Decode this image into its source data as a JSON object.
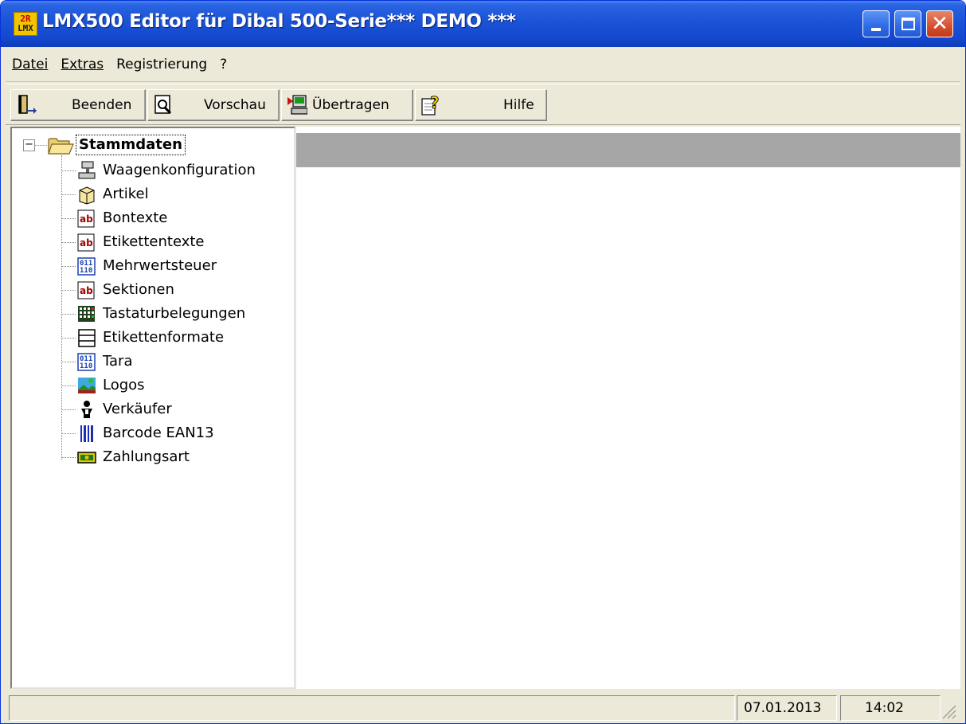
{
  "window": {
    "title": "LMX500 Editor für Dibal 500-Serie*** DEMO ***",
    "app_icon_top": "2R",
    "app_icon_bottom": "LMX"
  },
  "menu": {
    "items": [
      "Datei",
      "Extras",
      "Registrierung",
      "?"
    ]
  },
  "toolbar": {
    "beenden": "Beenden",
    "vorschau": "Vorschau",
    "uebertragen": "Übertragen",
    "hilfe": "Hilfe"
  },
  "tree": {
    "root": "Stammdaten",
    "items": [
      {
        "label": "Waagenkonfiguration",
        "icon": "scale-icon"
      },
      {
        "label": "Artikel",
        "icon": "box-icon"
      },
      {
        "label": "Bontexte",
        "icon": "text-ab-icon"
      },
      {
        "label": "Etikettentexte",
        "icon": "text-ab-icon"
      },
      {
        "label": "Mehrwertsteuer",
        "icon": "binary-icon"
      },
      {
        "label": "Sektionen",
        "icon": "text-ab-icon"
      },
      {
        "label": "Tastaturbelegungen",
        "icon": "keyboard-grid-icon"
      },
      {
        "label": "Etikettenformate",
        "icon": "label-format-icon"
      },
      {
        "label": "Tara",
        "icon": "binary-icon"
      },
      {
        "label": "Logos",
        "icon": "image-icon"
      },
      {
        "label": "Verkäufer",
        "icon": "person-icon"
      },
      {
        "label": "Barcode EAN13",
        "icon": "barcode-icon"
      },
      {
        "label": "Zahlungsart",
        "icon": "money-icon"
      }
    ]
  },
  "status": {
    "left": "",
    "date": "07.01.2013",
    "time": "14:02"
  }
}
